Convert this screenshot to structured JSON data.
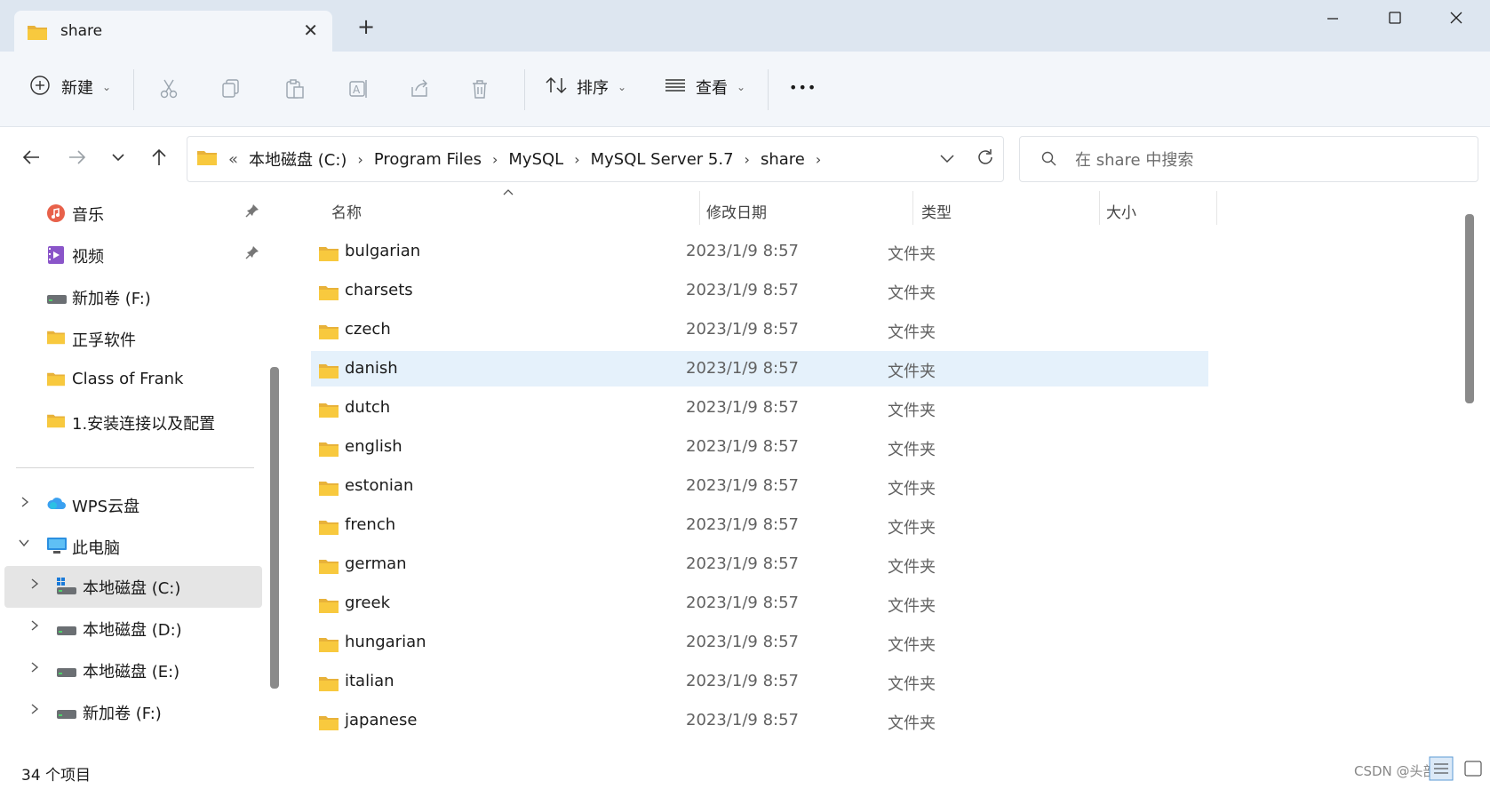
{
  "window": {
    "tab_title": "share",
    "new_tab_symbol": "+",
    "close_tab_symbol": "✕"
  },
  "toolbar": {
    "new_label": "新建",
    "sort_label": "排序",
    "view_label": "查看",
    "more_label": "•••"
  },
  "address": {
    "overflow": "«",
    "crumbs": [
      "本地磁盘 (C:)",
      "Program Files",
      "MySQL",
      "MySQL Server 5.7",
      "share"
    ]
  },
  "search": {
    "placeholder": "在 share 中搜索"
  },
  "nav": {
    "quick": [
      {
        "label": "音乐",
        "icon": "music-icon",
        "pinned": true
      },
      {
        "label": "视频",
        "icon": "video-icon",
        "pinned": true
      },
      {
        "label": "新加卷 (F:)",
        "icon": "drive-icon"
      },
      {
        "label": "正孚软件",
        "icon": "folder-icon"
      },
      {
        "label": "Class of Frank",
        "icon": "folder-icon"
      },
      {
        "label": "1.安装连接以及配置",
        "icon": "folder-icon"
      }
    ],
    "tree": [
      {
        "label": "WPS云盘",
        "icon": "cloud-icon"
      },
      {
        "label": "此电脑",
        "icon": "computer-icon"
      },
      {
        "label": "本地磁盘 (C:)",
        "icon": "windows-drive-icon",
        "selected": true
      },
      {
        "label": "本地磁盘 (D:)",
        "icon": "drive-icon"
      },
      {
        "label": "本地磁盘 (E:)",
        "icon": "drive-icon"
      },
      {
        "label": "新加卷 (F:)",
        "icon": "drive-icon"
      }
    ]
  },
  "columns": {
    "name": "名称",
    "date": "修改日期",
    "type": "类型",
    "size": "大小"
  },
  "files": [
    {
      "name": "bulgarian",
      "date": "2023/1/9 8:57",
      "type": "文件夹"
    },
    {
      "name": "charsets",
      "date": "2023/1/9 8:57",
      "type": "文件夹"
    },
    {
      "name": "czech",
      "date": "2023/1/9 8:57",
      "type": "文件夹"
    },
    {
      "name": "danish",
      "date": "2023/1/9 8:57",
      "type": "文件夹",
      "selected": true
    },
    {
      "name": "dutch",
      "date": "2023/1/9 8:57",
      "type": "文件夹"
    },
    {
      "name": "english",
      "date": "2023/1/9 8:57",
      "type": "文件夹"
    },
    {
      "name": "estonian",
      "date": "2023/1/9 8:57",
      "type": "文件夹"
    },
    {
      "name": "french",
      "date": "2023/1/9 8:57",
      "type": "文件夹"
    },
    {
      "name": "german",
      "date": "2023/1/9 8:57",
      "type": "文件夹"
    },
    {
      "name": "greek",
      "date": "2023/1/9 8:57",
      "type": "文件夹"
    },
    {
      "name": "hungarian",
      "date": "2023/1/9 8:57",
      "type": "文件夹"
    },
    {
      "name": "italian",
      "date": "2023/1/9 8:57",
      "type": "文件夹"
    },
    {
      "name": "japanese",
      "date": "2023/1/9 8:57",
      "type": "文件夹"
    }
  ],
  "status": {
    "item_count": "34 个项目",
    "watermark": "CSDN @头部"
  },
  "colors": {
    "titlebar": "#dde6f0",
    "toolbar": "#f3f6fa",
    "selected_row": "#e5f1fb",
    "folder_yellow": "#f8c93e"
  }
}
